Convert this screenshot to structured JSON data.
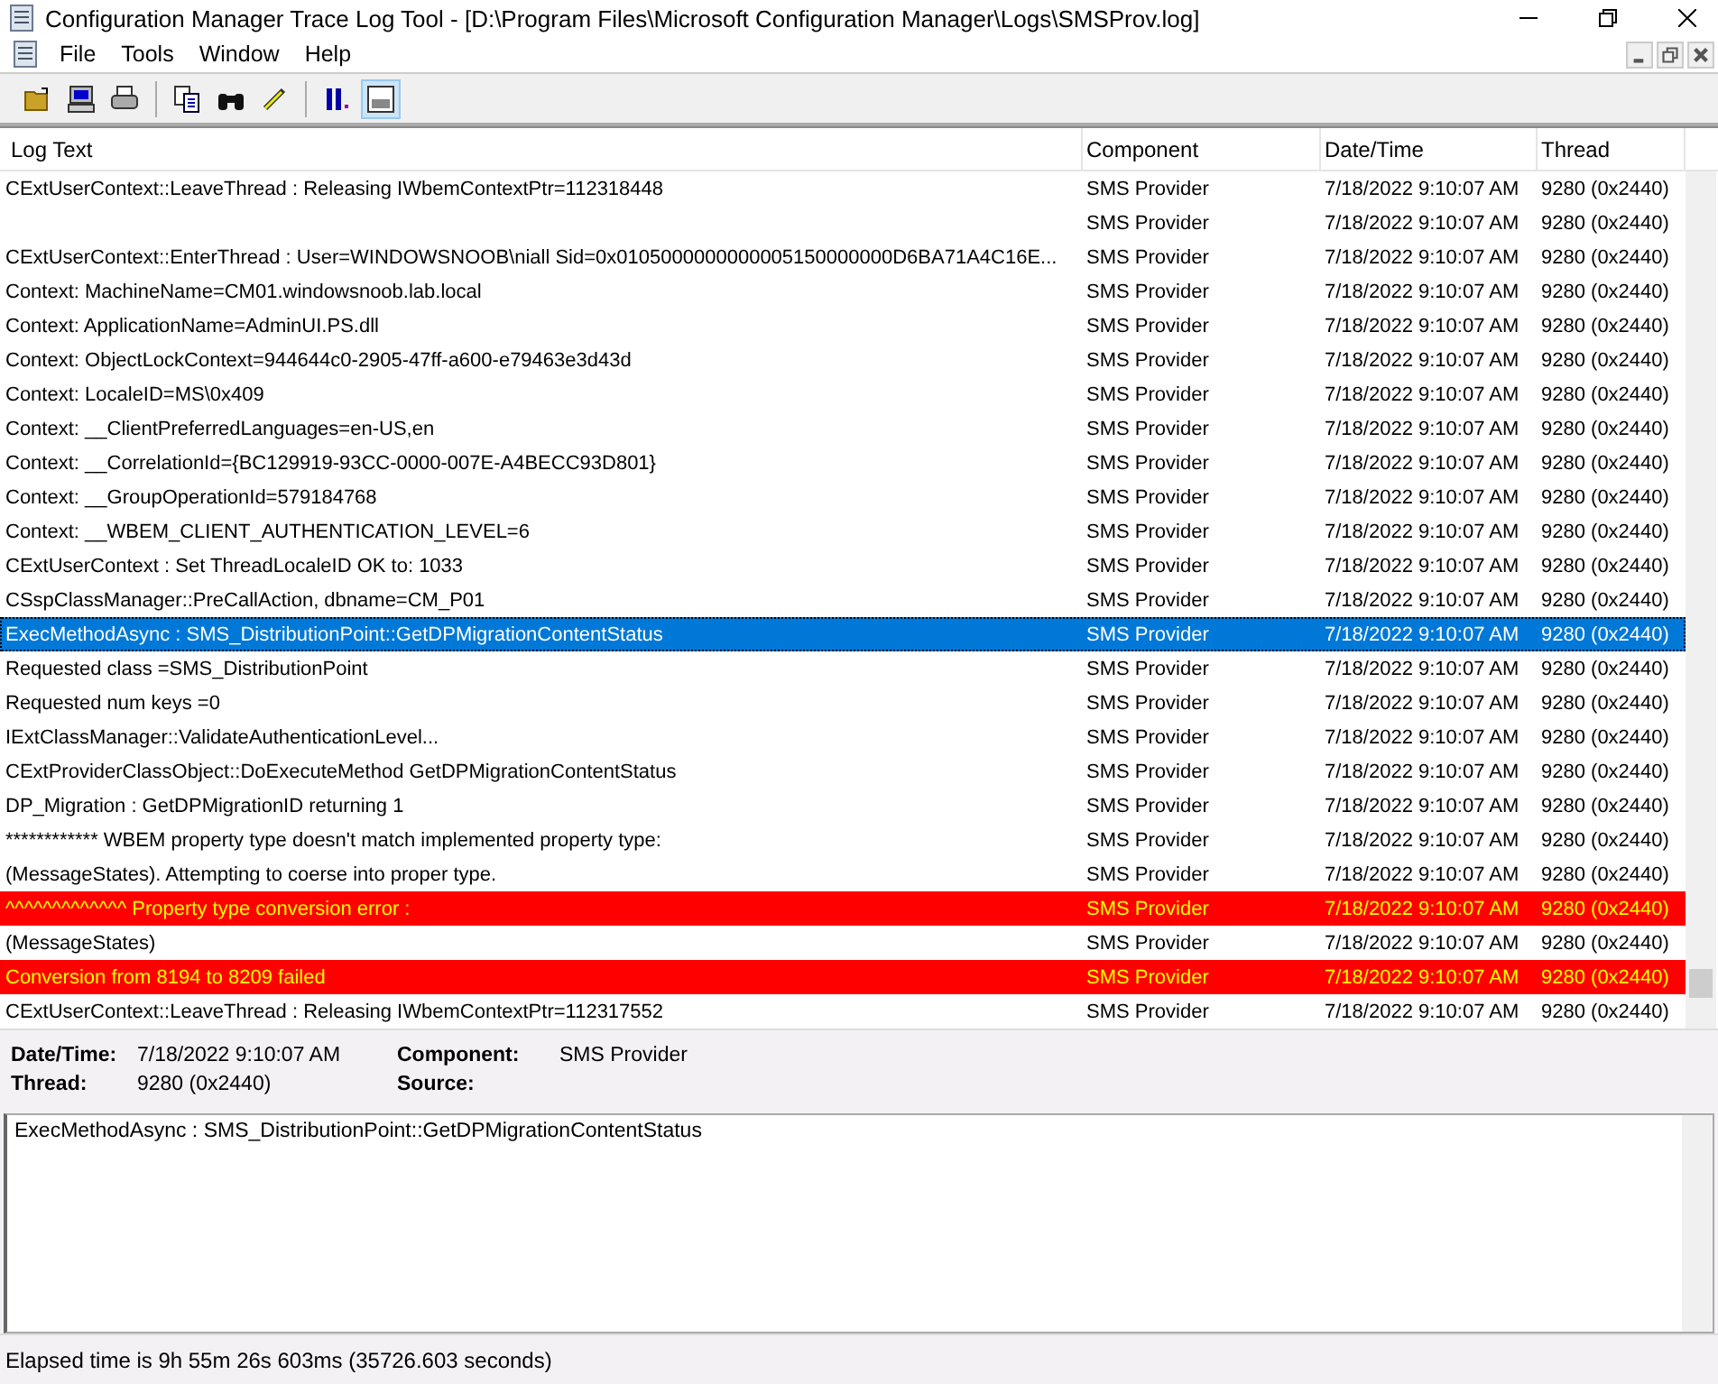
{
  "window": {
    "title": "Configuration Manager Trace Log Tool - [D:\\Program Files\\Microsoft Configuration Manager\\Logs\\SMSProv.log]"
  },
  "menu": [
    "File",
    "Tools",
    "Window",
    "Help"
  ],
  "toolbar": [
    {
      "kind": "open",
      "pressed": false
    },
    {
      "kind": "computer",
      "pressed": false
    },
    {
      "kind": "print",
      "pressed": false
    },
    {
      "kind": "sep"
    },
    {
      "kind": "copy",
      "pressed": false
    },
    {
      "kind": "find",
      "pressed": false
    },
    {
      "kind": "highlight",
      "pressed": false
    },
    {
      "kind": "sep"
    },
    {
      "kind": "pause",
      "pressed": false
    },
    {
      "kind": "info",
      "pressed": true
    }
  ],
  "table": {
    "columns": [
      "Log Text",
      "Component",
      "Date/Time",
      "Thread"
    ],
    "rows": [
      {
        "text": "CExtUserContext::LeaveThread : Releasing IWbemContextPtr=112318448",
        "component": "SMS Provider",
        "datetime": "7/18/2022 9:10:07 AM",
        "thread": "9280 (0x2440)",
        "kind": "normal",
        "selected": false
      },
      {
        "component": "SMS Provider",
        "datetime": "7/18/2022 9:10:07 AM",
        "thread": "9280 (0x2440)",
        "kind": "normal",
        "selected": false
      },
      {
        "text": "CExtUserContext::EnterThread : User=WINDOWSNOOB\\niall Sid=0x0105000000000005150000000D6BA71A4C16E...",
        "component": "SMS Provider",
        "datetime": "7/18/2022 9:10:07 AM",
        "thread": "9280 (0x2440)",
        "kind": "normal",
        "selected": false
      },
      {
        "text": "Context: MachineName=CM01.windowsnoob.lab.local",
        "component": "SMS Provider",
        "datetime": "7/18/2022 9:10:07 AM",
        "thread": "9280 (0x2440)",
        "kind": "normal",
        "selected": false
      },
      {
        "text": "Context: ApplicationName=AdminUI.PS.dll",
        "component": "SMS Provider",
        "datetime": "7/18/2022 9:10:07 AM",
        "thread": "9280 (0x2440)",
        "kind": "normal",
        "selected": false
      },
      {
        "text": "Context: ObjectLockContext=944644c0-2905-47ff-a600-e79463e3d43d",
        "component": "SMS Provider",
        "datetime": "7/18/2022 9:10:07 AM",
        "thread": "9280 (0x2440)",
        "kind": "normal",
        "selected": false
      },
      {
        "text": "Context: LocaleID=MS\\0x409",
        "component": "SMS Provider",
        "datetime": "7/18/2022 9:10:07 AM",
        "thread": "9280 (0x2440)",
        "kind": "normal",
        "selected": false
      },
      {
        "text": "Context: __ClientPreferredLanguages=en-US,en",
        "component": "SMS Provider",
        "datetime": "7/18/2022 9:10:07 AM",
        "thread": "9280 (0x2440)",
        "kind": "normal",
        "selected": false
      },
      {
        "text": "Context: __CorrelationId={BC129919-93CC-0000-007E-A4BECC93D801}",
        "component": "SMS Provider",
        "datetime": "7/18/2022 9:10:07 AM",
        "thread": "9280 (0x2440)",
        "kind": "normal",
        "selected": false
      },
      {
        "text": "Context: __GroupOperationId=579184768",
        "component": "SMS Provider",
        "datetime": "7/18/2022 9:10:07 AM",
        "thread": "9280 (0x2440)",
        "kind": "normal",
        "selected": false
      },
      {
        "text": "Context: __WBEM_CLIENT_AUTHENTICATION_LEVEL=6",
        "component": "SMS Provider",
        "datetime": "7/18/2022 9:10:07 AM",
        "thread": "9280 (0x2440)",
        "kind": "normal",
        "selected": false
      },
      {
        "text": "CExtUserContext : Set ThreadLocaleID OK to: 1033",
        "component": "SMS Provider",
        "datetime": "7/18/2022 9:10:07 AM",
        "thread": "9280 (0x2440)",
        "kind": "normal",
        "selected": false
      },
      {
        "text": "CSspClassManager::PreCallAction, dbname=CM_P01",
        "component": "SMS Provider",
        "datetime": "7/18/2022 9:10:07 AM",
        "thread": "9280 (0x2440)",
        "kind": "normal",
        "selected": false
      },
      {
        "text": "ExecMethodAsync : SMS_DistributionPoint::GetDPMigrationContentStatus",
        "component": "SMS Provider",
        "datetime": "7/18/2022 9:10:07 AM",
        "thread": "9280 (0x2440)",
        "kind": "normal",
        "selected": true
      },
      {
        "text": "Requested class =SMS_DistributionPoint",
        "component": "SMS Provider",
        "datetime": "7/18/2022 9:10:07 AM",
        "thread": "9280 (0x2440)",
        "kind": "normal",
        "selected": false
      },
      {
        "text": "Requested num keys =0",
        "component": "SMS Provider",
        "datetime": "7/18/2022 9:10:07 AM",
        "thread": "9280 (0x2440)",
        "kind": "normal",
        "selected": false
      },
      {
        "text": "IExtClassManager::ValidateAuthenticationLevel...",
        "component": "SMS Provider",
        "datetime": "7/18/2022 9:10:07 AM",
        "thread": "9280 (0x2440)",
        "kind": "normal",
        "selected": false
      },
      {
        "text": "CExtProviderClassObject::DoExecuteMethod GetDPMigrationContentStatus",
        "component": "SMS Provider",
        "datetime": "7/18/2022 9:10:07 AM",
        "thread": "9280 (0x2440)",
        "kind": "normal",
        "selected": false
      },
      {
        "text": "DP_Migration : GetDPMigrationID returning 1",
        "component": "SMS Provider",
        "datetime": "7/18/2022 9:10:07 AM",
        "thread": "9280 (0x2440)",
        "kind": "normal",
        "selected": false
      },
      {
        "text": "************ WBEM property type doesn't match implemented property type:",
        "component": "SMS Provider",
        "datetime": "7/18/2022 9:10:07 AM",
        "thread": "9280 (0x2440)",
        "kind": "normal",
        "selected": false
      },
      {
        "text": " (MessageStates).  Attempting to coerse into proper type.",
        "component": "SMS Provider",
        "datetime": "7/18/2022 9:10:07 AM",
        "thread": "9280 (0x2440)",
        "kind": "normal",
        "selected": false
      },
      {
        "text": "^^^^^^^^^^^^^ Property type conversion error :",
        "component": "SMS Provider",
        "datetime": "7/18/2022 9:10:07 AM",
        "thread": "9280 (0x2440)",
        "kind": "error",
        "selected": false
      },
      {
        "text": " (MessageStates)",
        "component": "SMS Provider",
        "datetime": "7/18/2022 9:10:07 AM",
        "thread": "9280 (0x2440)",
        "kind": "normal",
        "selected": false
      },
      {
        "text": "Conversion from 8194 to 8209 failed",
        "component": "SMS Provider",
        "datetime": "7/18/2022 9:10:07 AM",
        "thread": "9280 (0x2440)",
        "kind": "error",
        "selected": false
      },
      {
        "text": "CExtUserContext::LeaveThread : Releasing IWbemContextPtr=112317552",
        "component": "SMS Provider",
        "datetime": "7/18/2022 9:10:07 AM",
        "thread": "9280 (0x2440)",
        "kind": "normal",
        "selected": false
      }
    ]
  },
  "details": {
    "datetime_label": "Date/Time:",
    "datetime": "7/18/2022 9:10:07 AM",
    "component_label": "Component:",
    "component": "SMS Provider",
    "thread_label": "Thread:",
    "thread": "9280 (0x2440)",
    "source_label": "Source:"
  },
  "message": "ExecMethodAsync : SMS_DistributionPoint::GetDPMigrationContentStatus",
  "status_bar": "Elapsed time is 9h 55m 26s 603ms (35726.603 seconds)"
}
